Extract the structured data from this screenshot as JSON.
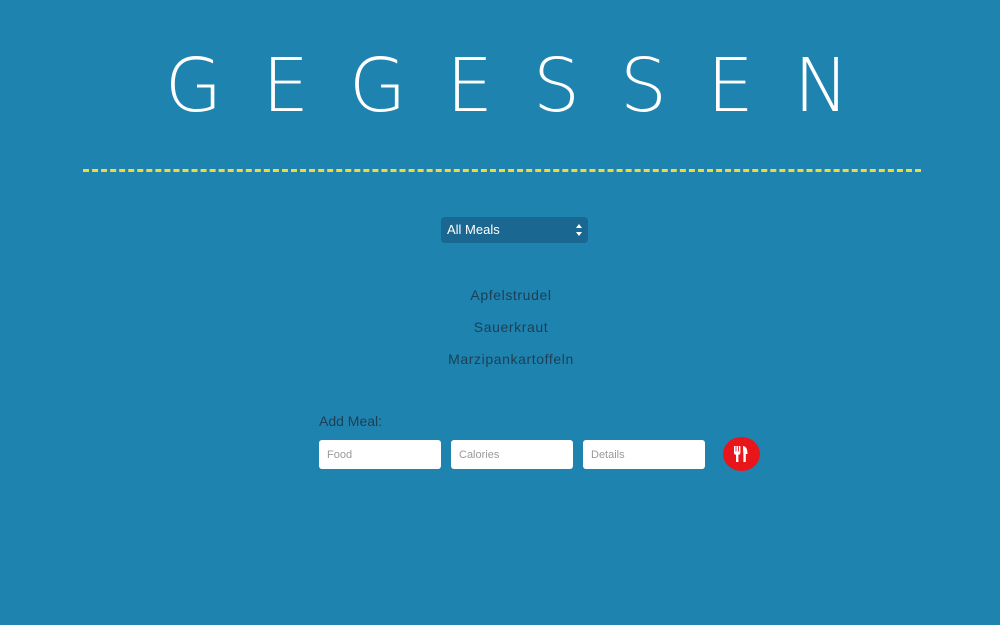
{
  "app": {
    "title": "GEGESSEN"
  },
  "colors": {
    "background": "#1e83ae",
    "divider": "#f2d83a",
    "select_background": "#1a6791",
    "add_button": "#e8161b",
    "meal_text": "#1d3f55"
  },
  "filter": {
    "selected": "All Meals"
  },
  "meals": [
    {
      "name": "Apfelstrudel"
    },
    {
      "name": "Sauerkraut"
    },
    {
      "name": "Marzipankartoffeln"
    }
  ],
  "add_form": {
    "label": "Add Meal:",
    "food_placeholder": "Food",
    "calories_placeholder": "Calories",
    "details_placeholder": "Details",
    "submit_icon": "fork-knife-icon"
  }
}
